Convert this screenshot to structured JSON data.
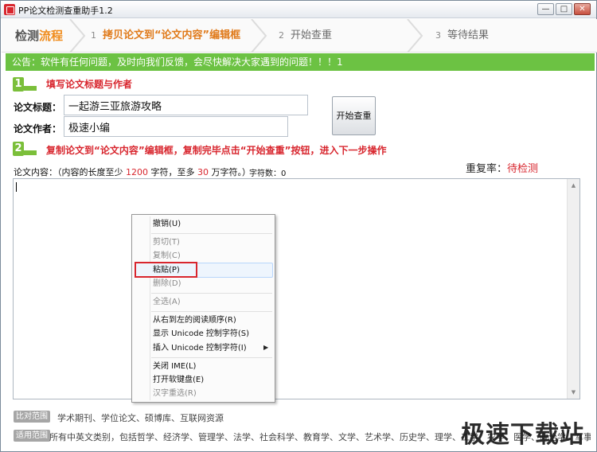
{
  "window": {
    "title": "PP论文检测查重助手1.2",
    "buttons": {
      "minimize": "—",
      "maximize": "□",
      "close": "✕"
    }
  },
  "steps": {
    "head_part1": "检测",
    "head_part2": "流程",
    "items": [
      {
        "num": "1",
        "label": "拷贝论文到“论文内容”编辑框"
      },
      {
        "num": "2",
        "label": "开始查重"
      },
      {
        "num": "3",
        "label": "等待结果"
      }
    ]
  },
  "notice": "公告：软件有任何问题，及时向我们反馈，会尽快解决大家遇到的问题！！！1",
  "section1": {
    "num": "1",
    "title": "填写论文标题与作者"
  },
  "form": {
    "title_label": "论文标题：",
    "title_value": "一起游三亚旅游攻略",
    "author_label": "论文作者：",
    "author_value": "极速小编",
    "start_button": "开始查重"
  },
  "section2": {
    "num": "2",
    "title": "复制论文到“论文内容”编辑框，复制完毕点击“开始查重”按钮，进入下一步操作"
  },
  "content": {
    "label_prefix": "论文内容：（内容的长度至少 ",
    "min_chars": "1200",
    "label_mid": " 字符，至多 ",
    "max_chars": "30",
    "label_suffix": " 万字符。）",
    "char_count_label": "字符数：",
    "char_count": "0",
    "editor_value": ""
  },
  "rate": {
    "label": "重复率：",
    "value": "待检测"
  },
  "context_menu": {
    "items": [
      {
        "label": "撤销(U)",
        "enabled": true
      },
      {
        "label": "剪切(T)",
        "enabled": false
      },
      {
        "label": "复制(C)",
        "enabled": false
      },
      {
        "label": "粘贴(P)",
        "enabled": true,
        "highlighted": true
      },
      {
        "label": "删除(D)",
        "enabled": false
      },
      {
        "label": "全选(A)",
        "enabled": false
      },
      {
        "label": "从右到左的阅读顺序(R)",
        "enabled": true
      },
      {
        "label": "显示 Unicode 控制字符(S)",
        "enabled": true
      },
      {
        "label": "插入 Unicode 控制字符(I)",
        "enabled": true,
        "submenu": true
      },
      {
        "label": "关闭 IME(L)",
        "enabled": true
      },
      {
        "label": "打开软键盘(E)",
        "enabled": true
      },
      {
        "label": "汉字重选(R)",
        "enabled": false
      }
    ]
  },
  "footer": {
    "compare_tag": "比对范围",
    "compare_text": "学术期刊、学位论文、硕博库、互联网资源",
    "scope_tag": "适用范围",
    "scope_text": "所有中英文类别，包括哲学、经济学、管理学、法学、社会科学、教育学、文学、艺术学、历史学、理学、工学、农学、医学、政治学、军事学"
  },
  "watermark": "极速下载站",
  "colors": {
    "accent_red": "#d8262e",
    "notice_green": "#6cc243",
    "step_active": "#e07a1a"
  }
}
